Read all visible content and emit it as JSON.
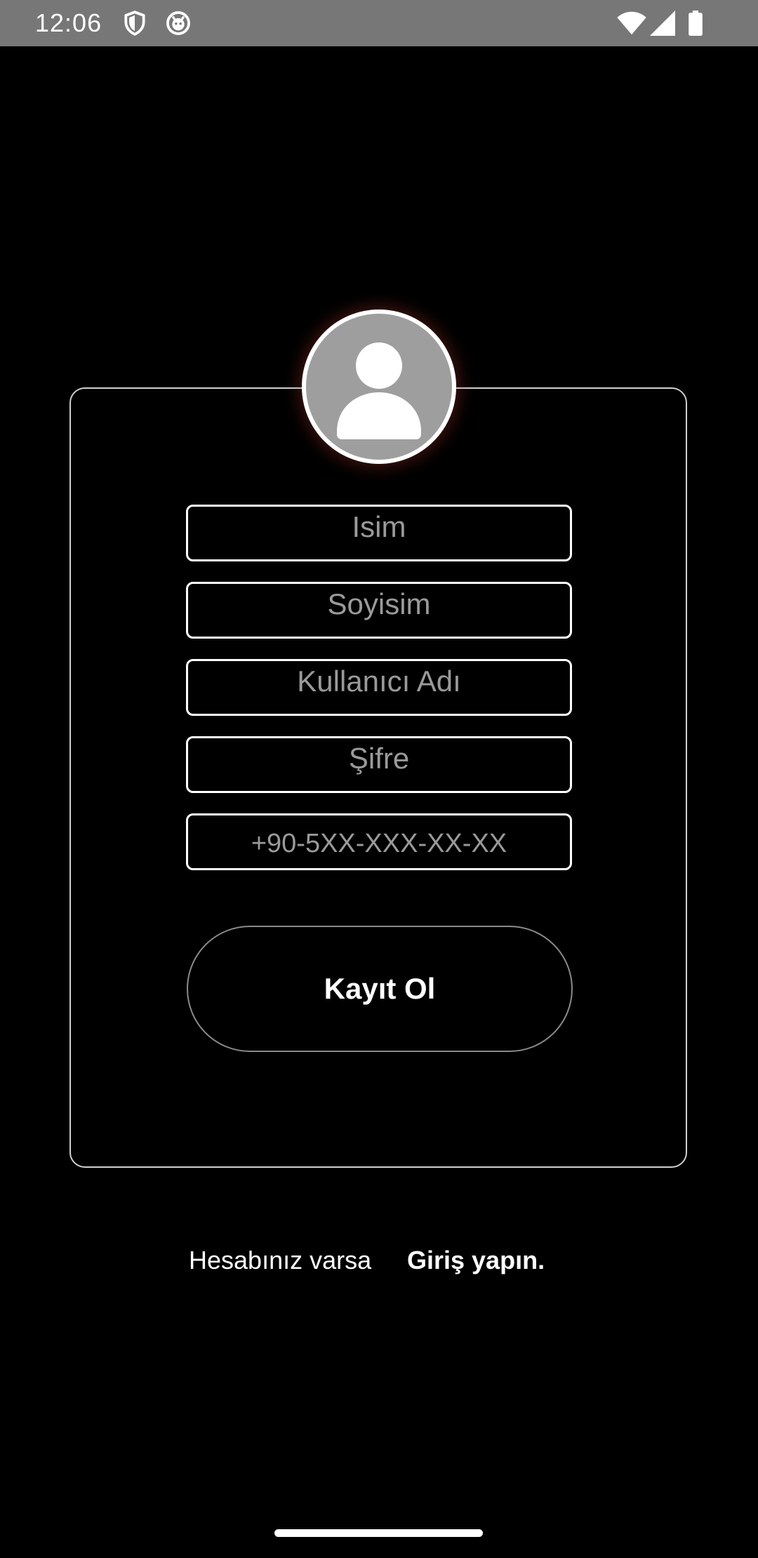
{
  "status_bar": {
    "time": "12:06",
    "left_icons": [
      "shield-icon",
      "cat-face-icon"
    ],
    "right_icons": [
      "wifi-icon",
      "signal-icon",
      "battery-icon"
    ]
  },
  "avatar": {
    "icon": "person-icon"
  },
  "form": {
    "first_name": {
      "placeholder": "Isim",
      "value": ""
    },
    "last_name": {
      "placeholder": "Soyisim",
      "value": ""
    },
    "username": {
      "placeholder": "Kullanıcı Adı",
      "value": ""
    },
    "password": {
      "placeholder": "Şifre",
      "value": ""
    },
    "phone": {
      "placeholder": "+90-5XX-XXX-XX-XX",
      "value": ""
    },
    "submit_label": "Kayıt Ol"
  },
  "footer": {
    "prompt": "Hesabınız varsa",
    "link": "Giriş yapın."
  },
  "colors": {
    "background": "#000000",
    "status_bar": "#777777",
    "avatar_fill": "#9e9e9e",
    "placeholder": "#9a9a9a",
    "card_border": "#cfcfcf"
  }
}
